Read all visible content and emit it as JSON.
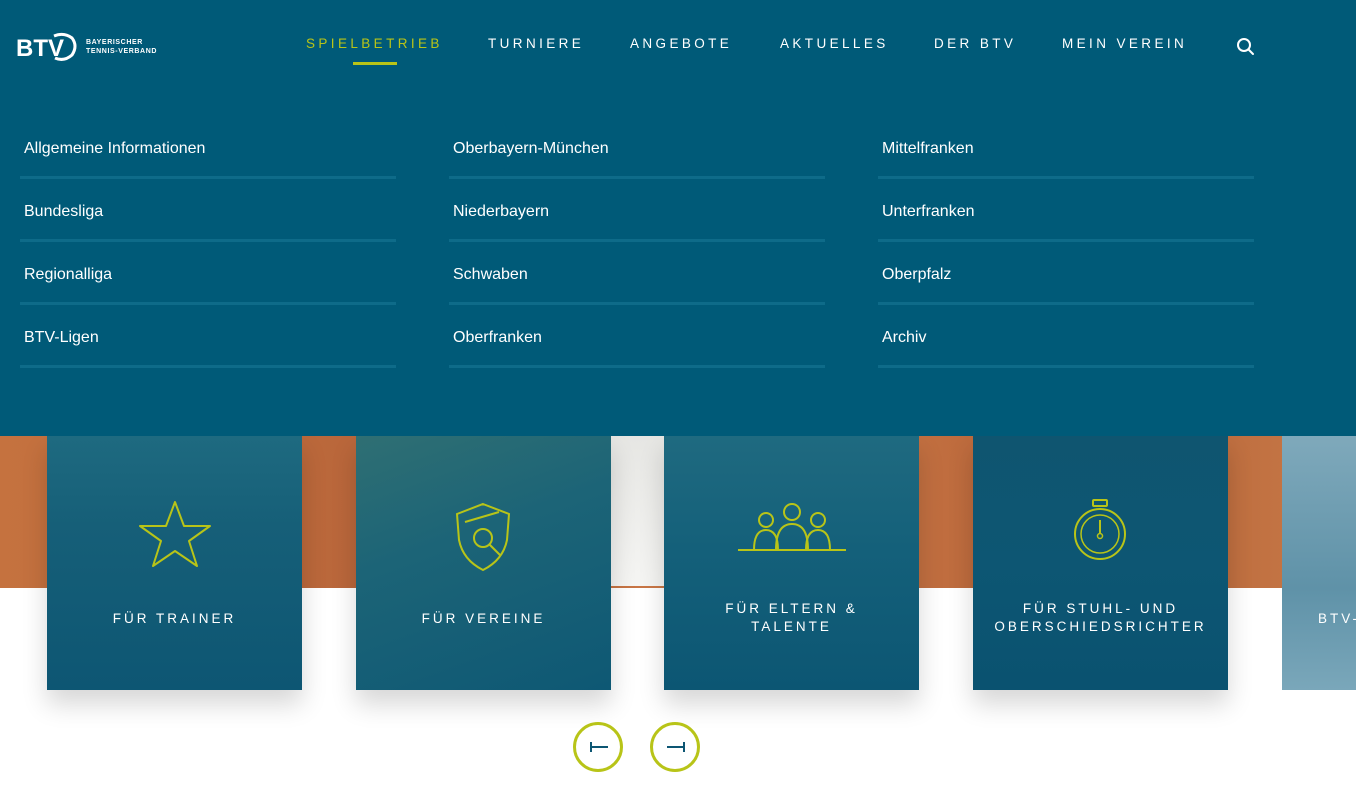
{
  "brand": {
    "mark": "BTV",
    "line1": "BAYERISCHER",
    "line2": "TENNIS-VERBAND"
  },
  "nav": [
    {
      "label": "SPIELBETRIEB",
      "active": true
    },
    {
      "label": "TURNIERE"
    },
    {
      "label": "ANGEBOTE"
    },
    {
      "label": "AKTUELLES"
    },
    {
      "label": "DER BTV"
    },
    {
      "label": "MEIN VEREIN"
    }
  ],
  "search_icon": "search-icon",
  "menu": {
    "col1": [
      "Allgemeine Informationen",
      "Bundesliga",
      "Regionalliga",
      "BTV-Ligen"
    ],
    "col2": [
      "Oberbayern-München",
      "Niederbayern",
      "Schwaben",
      "Oberfranken"
    ],
    "col3": [
      "Mittelfranken",
      "Unterfranken",
      "Oberpfalz",
      "Archiv"
    ]
  },
  "cards": [
    {
      "label": "FÜR TRAINER",
      "icon": "star-icon"
    },
    {
      "label": "FÜR VEREINE",
      "icon": "shield-icon"
    },
    {
      "line1": "FÜR ELTERN &",
      "line2": "TALENTE",
      "icon": "group-icon"
    },
    {
      "line1": "FÜR STUHL- UND",
      "line2": "OBERSCHIEDSRICHTER",
      "icon": "stopwatch-icon"
    },
    {
      "label": "BTV-",
      "icon": ""
    }
  ],
  "slider": {
    "prev_icon": "arrow-left-icon",
    "next_icon": "arrow-right-icon"
  },
  "colors": {
    "header_bg": "#005a78",
    "accent": "#b8c418",
    "card_bg": "#0d5b75"
  }
}
